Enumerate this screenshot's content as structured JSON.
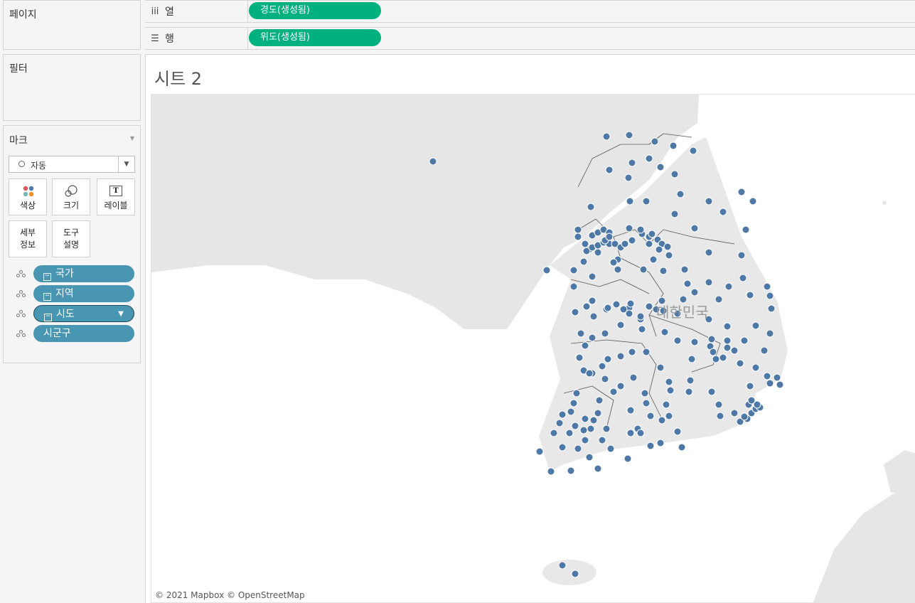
{
  "cards": {
    "pages_title": "페이지",
    "filters_title": "필터",
    "marks_title": "마크"
  },
  "shelves": {
    "columns": {
      "label": "열",
      "icon": "columns-icon",
      "pill": "경도(생성됨)"
    },
    "rows": {
      "label": "행",
      "icon": "rows-icon",
      "pill": "위도(생성됨)"
    }
  },
  "marks": {
    "mark_type": "자동",
    "buttons": {
      "color": "색상",
      "size": "크기",
      "label": "레이블",
      "detail_line1": "세부",
      "detail_line2": "정보",
      "tooltip_line1": "도구",
      "tooltip_line2": "설명"
    },
    "fields": [
      {
        "name": "국가"
      },
      {
        "name": "지역"
      },
      {
        "name": "시도"
      },
      {
        "name": "시군구"
      }
    ]
  },
  "sheet": {
    "title": "시트 2",
    "country_label": "대한민국",
    "copyright": "© 2021 Mapbox © OpenStreetMap",
    "mark_color": "#4e79a7"
  }
}
